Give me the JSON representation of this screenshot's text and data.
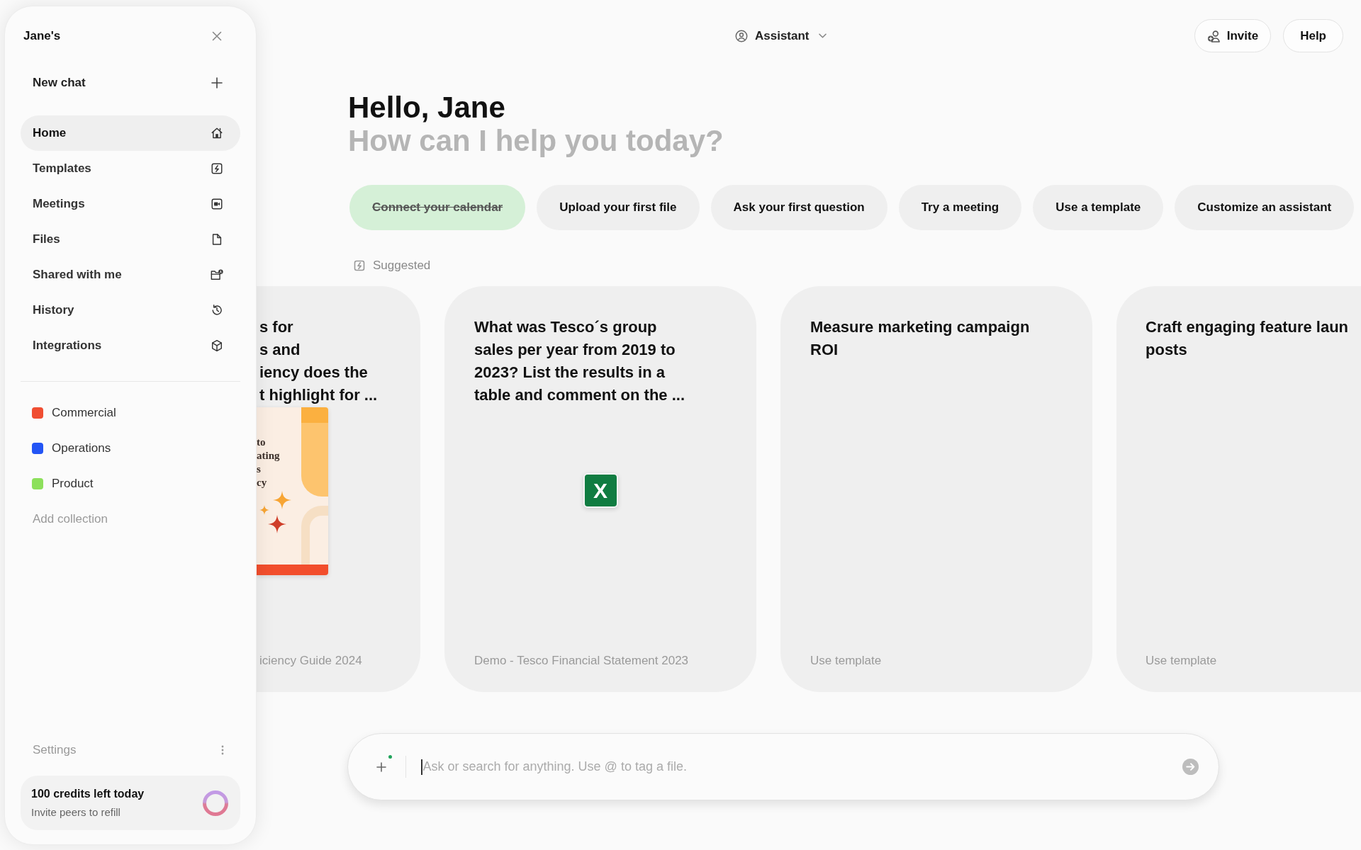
{
  "sidebar": {
    "workspace": "Jane's",
    "new_chat": "New chat",
    "nav": [
      {
        "label": "Home",
        "selected": true
      },
      {
        "label": "Templates",
        "selected": false
      },
      {
        "label": "Meetings",
        "selected": false
      },
      {
        "label": "Files",
        "selected": false
      },
      {
        "label": "Shared with me",
        "selected": false
      },
      {
        "label": "History",
        "selected": false
      },
      {
        "label": "Integrations",
        "selected": false
      }
    ],
    "collections": [
      {
        "label": "Commercial",
        "color": "#f04e32"
      },
      {
        "label": "Operations",
        "color": "#2355f5"
      },
      {
        "label": "Product",
        "color": "#8de05c"
      }
    ],
    "add_collection": "Add collection",
    "settings": "Settings",
    "credits": {
      "title": "100 credits left today",
      "subtitle": "Invite peers to refill"
    }
  },
  "header": {
    "assistant": "Assistant",
    "buttons": [
      {
        "label": "Invite",
        "kind": "invite"
      },
      {
        "label": "Help",
        "kind": "text"
      }
    ]
  },
  "greeting": {
    "title": "Hello, Jane",
    "subtitle": "How can I help you today?"
  },
  "onboarding_chips": [
    {
      "label": "Connect your calendar",
      "done": true
    },
    {
      "label": "Upload your first file",
      "done": false
    },
    {
      "label": "Ask your first question",
      "done": false
    },
    {
      "label": "Try a meeting",
      "done": false
    },
    {
      "label": "Use a template",
      "done": false
    },
    {
      "label": "Customize an assistant",
      "done": false
    }
  ],
  "suggested": {
    "label": "Suggested",
    "cards": [
      {
        "kind": "document",
        "title_lines": [
          "s for",
          "s and",
          "iency does the",
          "t highlight for ..."
        ],
        "cover_lines": [
          "to",
          "ating",
          "s",
          "cy"
        ],
        "footer": "iciency Guide 2024"
      },
      {
        "kind": "spreadsheet",
        "title_lines": [
          "What was Tesco´s group",
          "sales per year from 2019 to",
          "2023? List the results in a",
          "table and comment on the ..."
        ],
        "badge": "X",
        "footer": "Demo - Tesco Financial Statement 2023"
      },
      {
        "kind": "template",
        "title_lines": [
          "Measure marketing campaign",
          "ROI"
        ],
        "footer": "Use template"
      },
      {
        "kind": "template",
        "title_lines": [
          "Craft engaging feature laun",
          "posts"
        ],
        "footer": "Use template"
      }
    ]
  },
  "composer": {
    "placeholder": "Ask or search for anything. Use @ to tag a file."
  }
}
